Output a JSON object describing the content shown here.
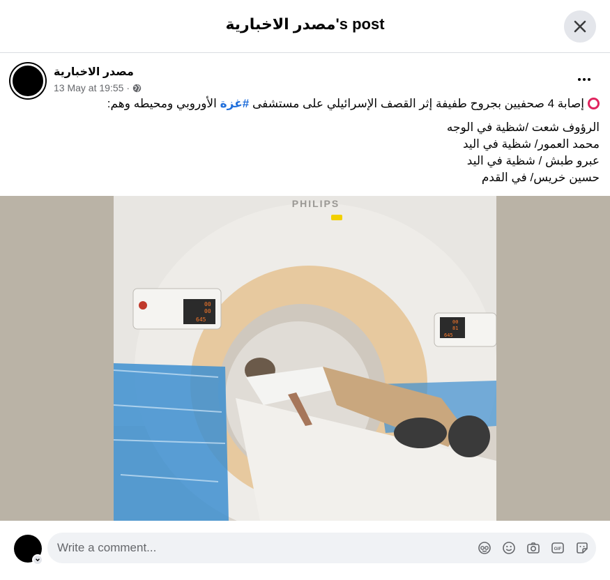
{
  "dialog": {
    "title": "مصدر الاخبارية's post"
  },
  "post": {
    "author_name": "مصدر الاخبارية",
    "timestamp": "13 May at 19:55",
    "audience_icon": "globe-icon",
    "text": {
      "line1_before": "إصابة 4 صحفيين بجروح طفيفة إثر القصف الإسرائيلي على مستشفى ",
      "hashtag": "#غزة",
      "line1_after": " الأوروبي ومحيطه وهم:",
      "names": [
        "الرؤوف شعت /شظية في الوجه",
        "محمد العمور/ شظية في اليد",
        "عبرو طبش / شظية في اليد",
        "حسين خريس/ في القدم"
      ]
    },
    "photo": {
      "scanner_brand": "PHILIPS",
      "panel_left_readouts": [
        "00",
        "00",
        "645"
      ],
      "panel_right_readouts": [
        "00",
        "81",
        "645"
      ]
    }
  },
  "comment_composer": {
    "placeholder": "Write a comment...",
    "tools": [
      "avatar-sticker-icon",
      "emoji-icon",
      "camera-icon",
      "gif-icon",
      "sticker-icon"
    ]
  },
  "colors": {
    "hashtag": "#216fdb",
    "secondary_text": "#65676b",
    "input_bg": "#f0f2f5",
    "red_ring": "#e0245e"
  }
}
